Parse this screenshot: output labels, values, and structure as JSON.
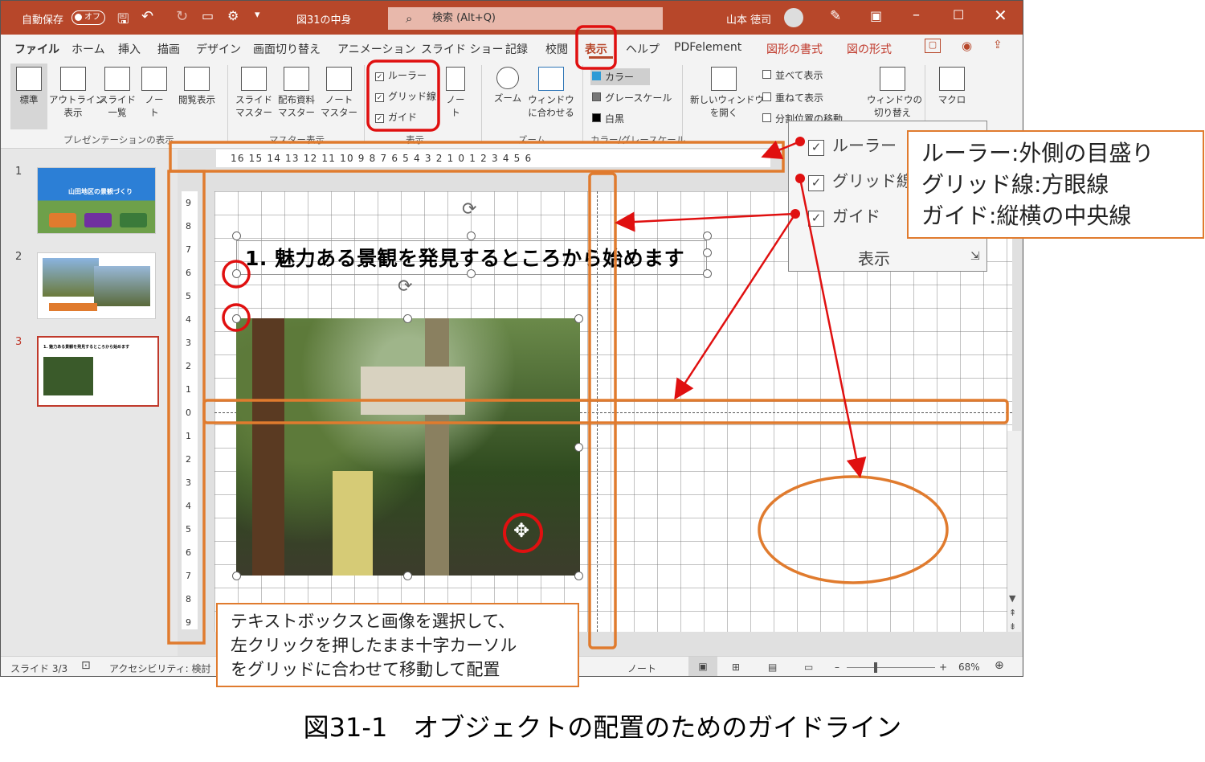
{
  "titlebar": {
    "autosave": "自動保存",
    "toggle": "オフ",
    "filename": "図31の中身",
    "search": "検索 (Alt+Q)",
    "user": "山本 徳司"
  },
  "tabs": [
    "ファイル",
    "ホーム",
    "挿入",
    "描画",
    "デザイン",
    "画面切り替え",
    "アニメーション",
    "スライド ショー",
    "記録",
    "校閲",
    "表示",
    "ヘルプ",
    "PDFelement",
    "図形の書式",
    "図の形式"
  ],
  "ribbon": {
    "buttons": [
      "標準",
      "アウトライン\n表示",
      "スライド\n一覧",
      "ノー\nト",
      "閲覧表示",
      "スライド\nマスター",
      "配布資料\nマスター",
      "ノート\nマスター",
      "ノー\nト",
      "ズーム",
      "ウィンドウ\nに合わせる",
      "新しいウィンドウ\nを開く",
      "ウィンドウの\n切り替え",
      "マクロ"
    ],
    "checks": [
      "ルーラー",
      "グリッド線",
      "ガイド"
    ],
    "color": [
      "カラー",
      "グレースケール",
      "白黒"
    ],
    "window": [
      "並べて表示",
      "重ねて表示",
      "分割位置の移動"
    ],
    "groups": [
      "プレゼンテーションの表示",
      "マスター表示",
      "表示",
      "ズーム",
      "カラー/グレースケール"
    ]
  },
  "thumbnails": [
    {
      "num": "1",
      "title": "山田地区の景観づくり"
    },
    {
      "num": "2",
      "title": ""
    },
    {
      "num": "3",
      "title": "1. 魅力ある景観を発見するところから始めます"
    }
  ],
  "ruler": {
    "h": "16 15 14 13 12 11 10 9 8 7 6 5 4 3 2 1 0 1 2 3 4 5 6",
    "v": [
      "9",
      "8",
      "7",
      "6",
      "5",
      "4",
      "3",
      "2",
      "1",
      "0",
      "1",
      "2",
      "3",
      "4",
      "5",
      "6",
      "7",
      "8",
      "9"
    ]
  },
  "slide": {
    "title": "1. 魅力ある景観を発見するところから始めます"
  },
  "popup": {
    "checks": [
      "ルーラー",
      "グリッド線",
      "ガイド"
    ],
    "group": "表示"
  },
  "callout": [
    "ルーラー:外側の目盛り",
    "グリッド線:方眼線",
    "ガイド:縦横の中央線"
  ],
  "note": [
    "テキストボックスと画像を選択して、",
    "左クリックを押したまま十字カーソル",
    "をグリッドに合わせて移動して配置"
  ],
  "status": {
    "slide": "スライド 3/3",
    "access": "アクセシビリティ: 検討",
    "notes": "ノート",
    "zoom": "68%"
  },
  "caption": "図31-1　オブジェクトの配置のためのガイドライン"
}
